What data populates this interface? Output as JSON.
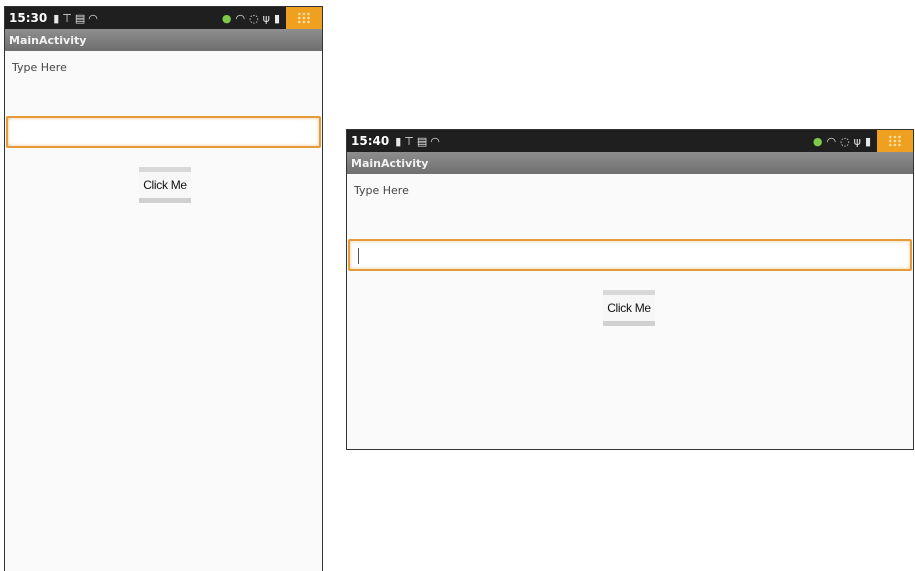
{
  "screens": [
    {
      "id": "portrait",
      "status": {
        "time": "15:30"
      },
      "title": "MainActivity",
      "label": "Type Here",
      "input_value": "",
      "button_label": "Click Me"
    },
    {
      "id": "landscape",
      "status": {
        "time": "15:40"
      },
      "title": "MainActivity",
      "label": "Type Here",
      "input_value": "",
      "button_label": "Click Me"
    }
  ],
  "colors": {
    "status_bar": "#1f1f1f",
    "title_bar": "#7a7a7a",
    "menu_tab": "#f0a020",
    "focus_border": "#e49b3c"
  },
  "icons": {
    "left": [
      "sd-card-icon",
      "signal-icon",
      "notification-icon",
      "wifi-icon"
    ],
    "right": [
      "sync-icon",
      "wifi-icon",
      "circle-icon",
      "usb-icon",
      "battery-icon"
    ]
  }
}
